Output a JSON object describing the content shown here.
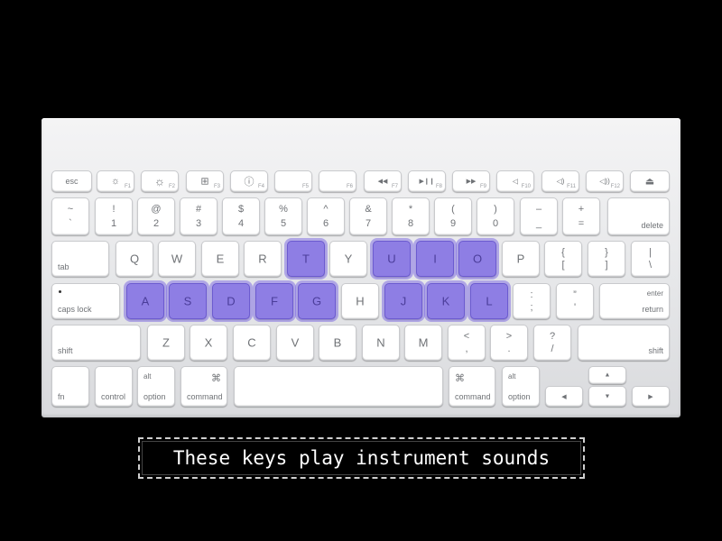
{
  "caption": "These keys play instrument sounds",
  "colors": {
    "background": "#000000",
    "keyboard_body": "#e6e7e9",
    "key": "#ffffff",
    "highlight": "#8e7ee4",
    "key_text": "#6f7276"
  },
  "highlighted_keys": [
    "T",
    "U",
    "I",
    "O",
    "A",
    "S",
    "D",
    "F",
    "G",
    "J",
    "K",
    "L"
  ],
  "keys": {
    "esc": "esc",
    "f1": "F1",
    "f2": "F2",
    "f3": "F3",
    "f4": "F4",
    "f5": "F5",
    "f6": "F6",
    "f7": "F7",
    "f8": "F8",
    "f9": "F9",
    "f10": "F10",
    "f11": "F11",
    "f12": "F12",
    "icon_brightness": "☼",
    "icon_expose": "⊞",
    "icon_dashboard": "ⓘ",
    "icon_rewind": "◀◀",
    "icon_playpause": "▶❙❙",
    "icon_forward": "▶▶",
    "icon_mute": "◁",
    "icon_vol_down": "◁)",
    "icon_vol_up": "◁))",
    "icon_eject": "⏏",
    "tilde": "~",
    "backtick": "`",
    "n1": "1",
    "s1": "!",
    "n2": "2",
    "s2": "@",
    "n3": "3",
    "s3": "#",
    "n4": "4",
    "s4": "$",
    "n5": "5",
    "s5": "%",
    "n6": "6",
    "s6": "^",
    "n7": "7",
    "s7": "&",
    "n8": "8",
    "s8": "*",
    "n9": "9",
    "s9": "(",
    "n0": "0",
    "s0": ")",
    "minus": "–",
    "underscore": "_",
    "equals": "=",
    "plus": "+",
    "delete": "delete",
    "tab": "tab",
    "q": "Q",
    "w": "W",
    "e": "E",
    "r": "R",
    "t": "T",
    "y": "Y",
    "u": "U",
    "i": "I",
    "o": "O",
    "p": "P",
    "lbrace": "{",
    "lbracket": "[",
    "rbrace": "}",
    "rbracket": "]",
    "pipe": "|",
    "backslash": "\\",
    "caps_lock": "caps lock",
    "a": "A",
    "s": "S",
    "d": "D",
    "f": "F",
    "g": "G",
    "h": "H",
    "j": "J",
    "k": "K",
    "l": "L",
    "colon": ":",
    "semicolon": ";",
    "quote_top": "”",
    "quote_bottom": "'",
    "enter": "enter",
    "return": "return",
    "shift": "shift",
    "z": "Z",
    "x": "X",
    "c": "C",
    "v": "V",
    "b": "B",
    "n": "N",
    "m": "M",
    "lt": "<",
    "comma": ",",
    "gt": ">",
    "period": ".",
    "question": "?",
    "slash": "/",
    "fn": "fn",
    "control": "control",
    "alt": "alt",
    "option": "option",
    "cmd_symbol": "⌘",
    "command": "command",
    "arrow_up": "▲",
    "arrow_left": "◀",
    "arrow_down": "▼",
    "arrow_right": "▶"
  }
}
